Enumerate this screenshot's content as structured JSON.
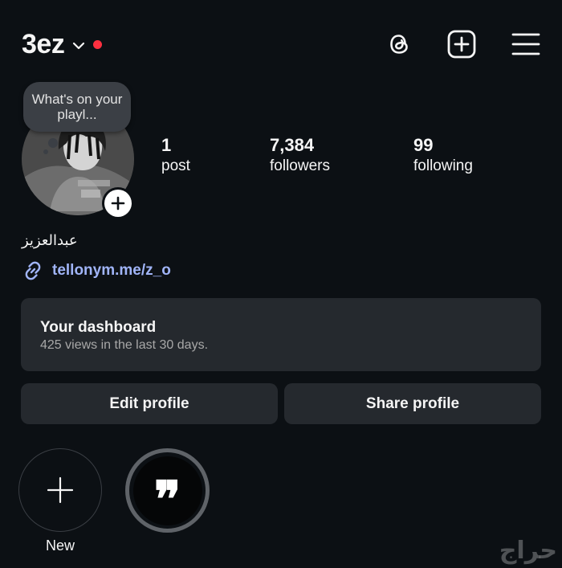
{
  "header": {
    "username": "3ez",
    "has_notification_dot": true,
    "icons": [
      "threads-icon",
      "create-icon",
      "menu-icon"
    ]
  },
  "profile": {
    "note": "What's on your playl...",
    "full_name": "عبدالعزيز",
    "link": "tellonym.me/z_o"
  },
  "stats": [
    {
      "value": "1",
      "label": "post"
    },
    {
      "value": "7,384",
      "label": "followers"
    },
    {
      "value": "99",
      "label": "following"
    }
  ],
  "dashboard": {
    "title": "Your dashboard",
    "subtitle": "425 views in the last 30 days."
  },
  "buttons": {
    "edit": "Edit profile",
    "share": "Share profile"
  },
  "highlights": {
    "new_label": "New",
    "quote_glyph": "❞"
  },
  "watermark": "حراج",
  "colors": {
    "background": "#0c1014",
    "card": "#25292e",
    "link": "#a0b4f7",
    "notification_dot": "#ff3040"
  }
}
